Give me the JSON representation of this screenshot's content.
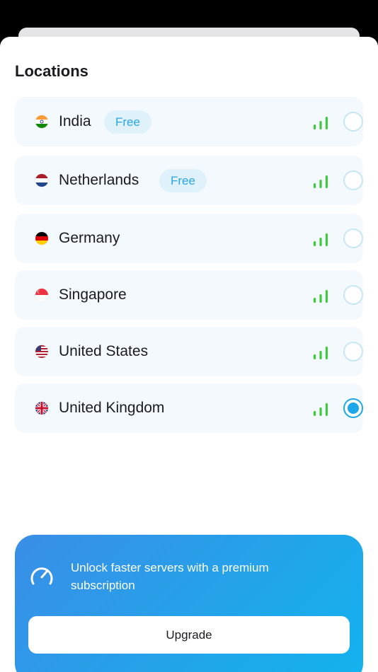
{
  "header": {
    "title": "Locations"
  },
  "locations": [
    {
      "name": "India",
      "badge": "Free",
      "flag": "india-flag-icon",
      "selected": false
    },
    {
      "name": "Netherlands",
      "badge": "Free",
      "flag": "netherlands-flag-icon",
      "selected": false
    },
    {
      "name": "Germany",
      "flag": "germany-flag-icon",
      "selected": false
    },
    {
      "name": "Singapore",
      "flag": "singapore-flag-icon",
      "selected": false
    },
    {
      "name": "United States",
      "flag": "united-states-flag-icon",
      "selected": false
    },
    {
      "name": "United Kingdom",
      "flag": "united-kingdom-flag-icon",
      "selected": true
    }
  ],
  "signal": {
    "icon": "signal-strength-icon",
    "color": "#3ec93e"
  },
  "promo": {
    "icon": "speedometer-icon",
    "text": "Unlock faster servers with a premium subscription",
    "button_label": "Upgrade",
    "gradient": [
      "#3a8ee6",
      "#12b3ee"
    ]
  },
  "colors": {
    "accent": "#1ea7e8",
    "badge_bg": "#dff2fb",
    "badge_text": "#28a6e3"
  }
}
